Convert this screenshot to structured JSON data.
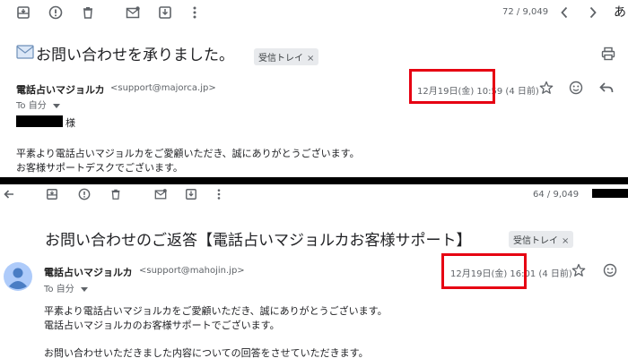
{
  "top": {
    "counter": "72 / 9,049",
    "input_char": "あ",
    "subject_icon": "envelope-emoji",
    "subject": "お問い合わせを承りました。",
    "label": "受信トレイ",
    "label_close": "×",
    "sender_name": "電話占いマジョルカ",
    "sender_email": "<support@majorca.jp>",
    "date": "12月19日(金) 10:59 (4 日前)",
    "to": "To 自分",
    "recipient_suffix": "様",
    "body": [
      "平素より電話占いマジョルカをご愛顧いただき、誠にありがとうございます。",
      "お客様サポートデスクでございます。"
    ]
  },
  "bottom": {
    "counter": "64 / 9,049",
    "subject": "お問い合わせのご返答【電話占いマジョルカお客様サポート】",
    "label": "受信トレイ",
    "label_close": "×",
    "sender_name": "電話占いマジョルカ",
    "sender_email": "<support@mahojin.jp>",
    "date": "12月19日(金) 16:01 (4 日前)",
    "to": "To 自分",
    "body": [
      "平素より電話占いマジョルカをご愛顧いただき、誠にありがとうございます。",
      "電話占いマジョルカのお客様サポートでございます。",
      "",
      "お問い合わせいただきました内容についての回答をさせていただきます。"
    ]
  },
  "colors": {
    "highlight": "#e60012",
    "icon_gray": "#5f6368",
    "avatar_bg": "#aecbfa",
    "avatar_fg": "#4a7dc4",
    "redaction": "#000000"
  }
}
